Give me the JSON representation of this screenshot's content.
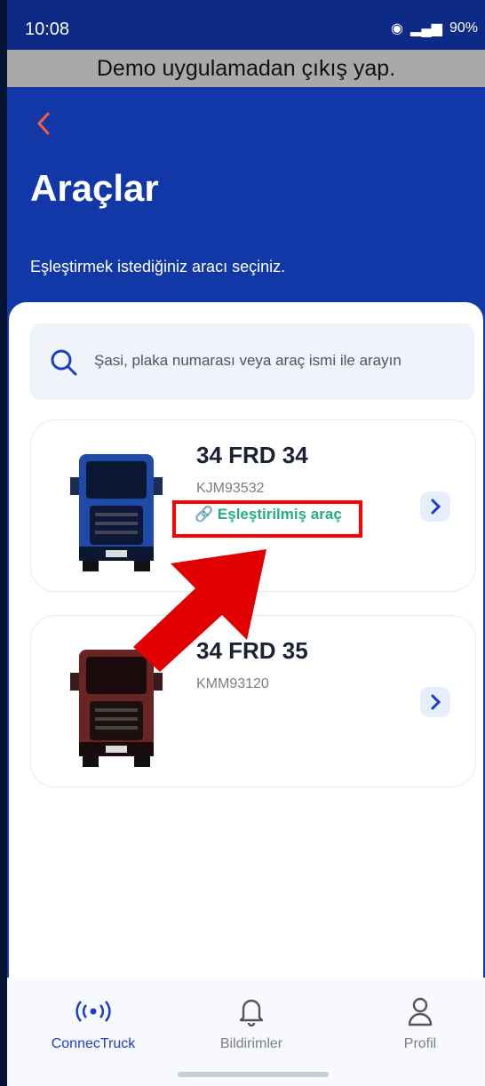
{
  "status_bar": {
    "time": "10:08",
    "battery": "90%"
  },
  "banner": {
    "text": "Demo uygulamadan çıkış yap."
  },
  "header": {
    "back_icon": "chevron-left-icon",
    "title": "Araçlar",
    "subtitle": "Eşleştirmek istediğiniz aracı seçiniz."
  },
  "search": {
    "placeholder": "Şasi, plaka numarası veya araç ismi ile arayın"
  },
  "vehicles": [
    {
      "plate": "34 FRD 34",
      "vin": "KJM93532",
      "status": "Eşleştirilmiş araç",
      "color": "#1f4aa6"
    },
    {
      "plate": "34 FRD 35",
      "vin": "KMM93120",
      "status": "",
      "color": "#6b2424"
    }
  ],
  "tabs": [
    {
      "label": "ConnecTruck",
      "icon": "signal-icon",
      "active": true
    },
    {
      "label": "Bildirimler",
      "icon": "bell-icon",
      "active": false
    },
    {
      "label": "Profil",
      "icon": "user-icon",
      "active": false
    }
  ],
  "colors": {
    "primary": "#1238a8",
    "accent": "#ff5a3d",
    "success": "#23b07c",
    "highlight": "#ff0000"
  }
}
